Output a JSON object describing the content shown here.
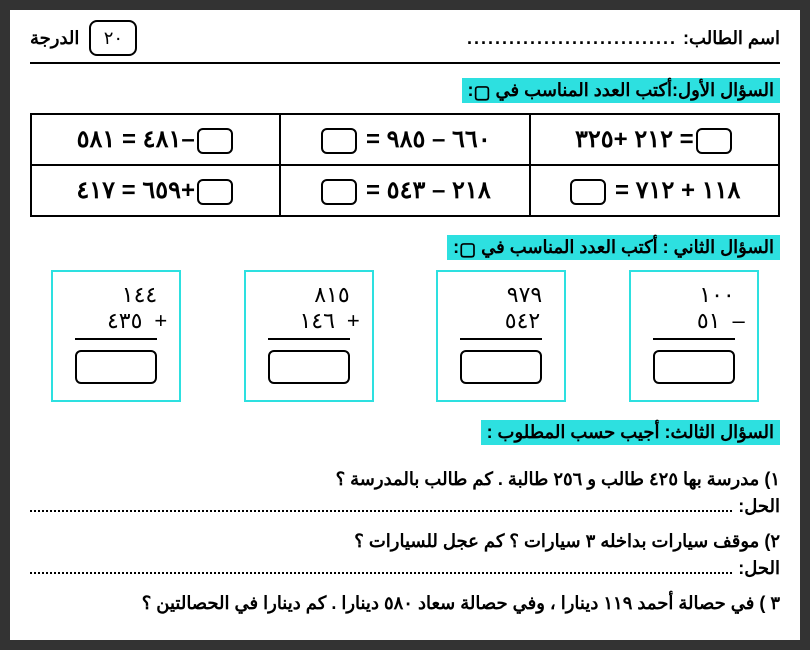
{
  "header": {
    "student_label": "اسم الطالب:",
    "dots": "..............................",
    "grade_label": "الدرجة",
    "score": "٢٠"
  },
  "q1": {
    "title_prefix": "السؤال الأول:أكتب العدد المناسب في ",
    "title_suffix": ":",
    "cells": {
      "r1c1": "٢١٢ +٣٢٥ =",
      "r1c2": "= ٦٦٠ – ٩٨٥",
      "r1c3_a": "٤٨١ = ٥٨١–",
      "r2c1": "= ١١٨ + ٧١٢",
      "r2c2": "= ٢١٨ – ٥٤٣",
      "r2c3_a": "٦٥٩ = ٤١٧+"
    }
  },
  "q2": {
    "title_prefix": "السؤال الثاني : أكتب العدد المناسب في ",
    "title_suffix": ":",
    "problems": [
      {
        "top": "١٤٤",
        "bottom": "٤٣٥",
        "op": "+"
      },
      {
        "top": "٨١٥",
        "bottom": "١٤٦",
        "op": "+"
      },
      {
        "top": "٩٧٩",
        "bottom": "٥٤٢",
        "op": ""
      },
      {
        "top": "١٠٠",
        "bottom": "٥١",
        "op": "–"
      }
    ]
  },
  "q3": {
    "title": "السؤال الثالث: أجيب حسب المطلوب :",
    "p1": "١) مدرسة بها  ٤٢٥ طالب و  ٢٥٦  طالبة  . كم  طالب بالمدرسة ؟",
    "p2": "٢) موقف سيارات بداخله ٣ سيارات ؟ كم عجل للسيارات ؟",
    "p3": "٣ ) في حصالة أحمد ١١٩ دينارا  ، وفي حصالة سعاد ٥٨٠ دينارا  . كم دينارا  في  الحصالتين ؟",
    "solution_label": "الحل:"
  }
}
